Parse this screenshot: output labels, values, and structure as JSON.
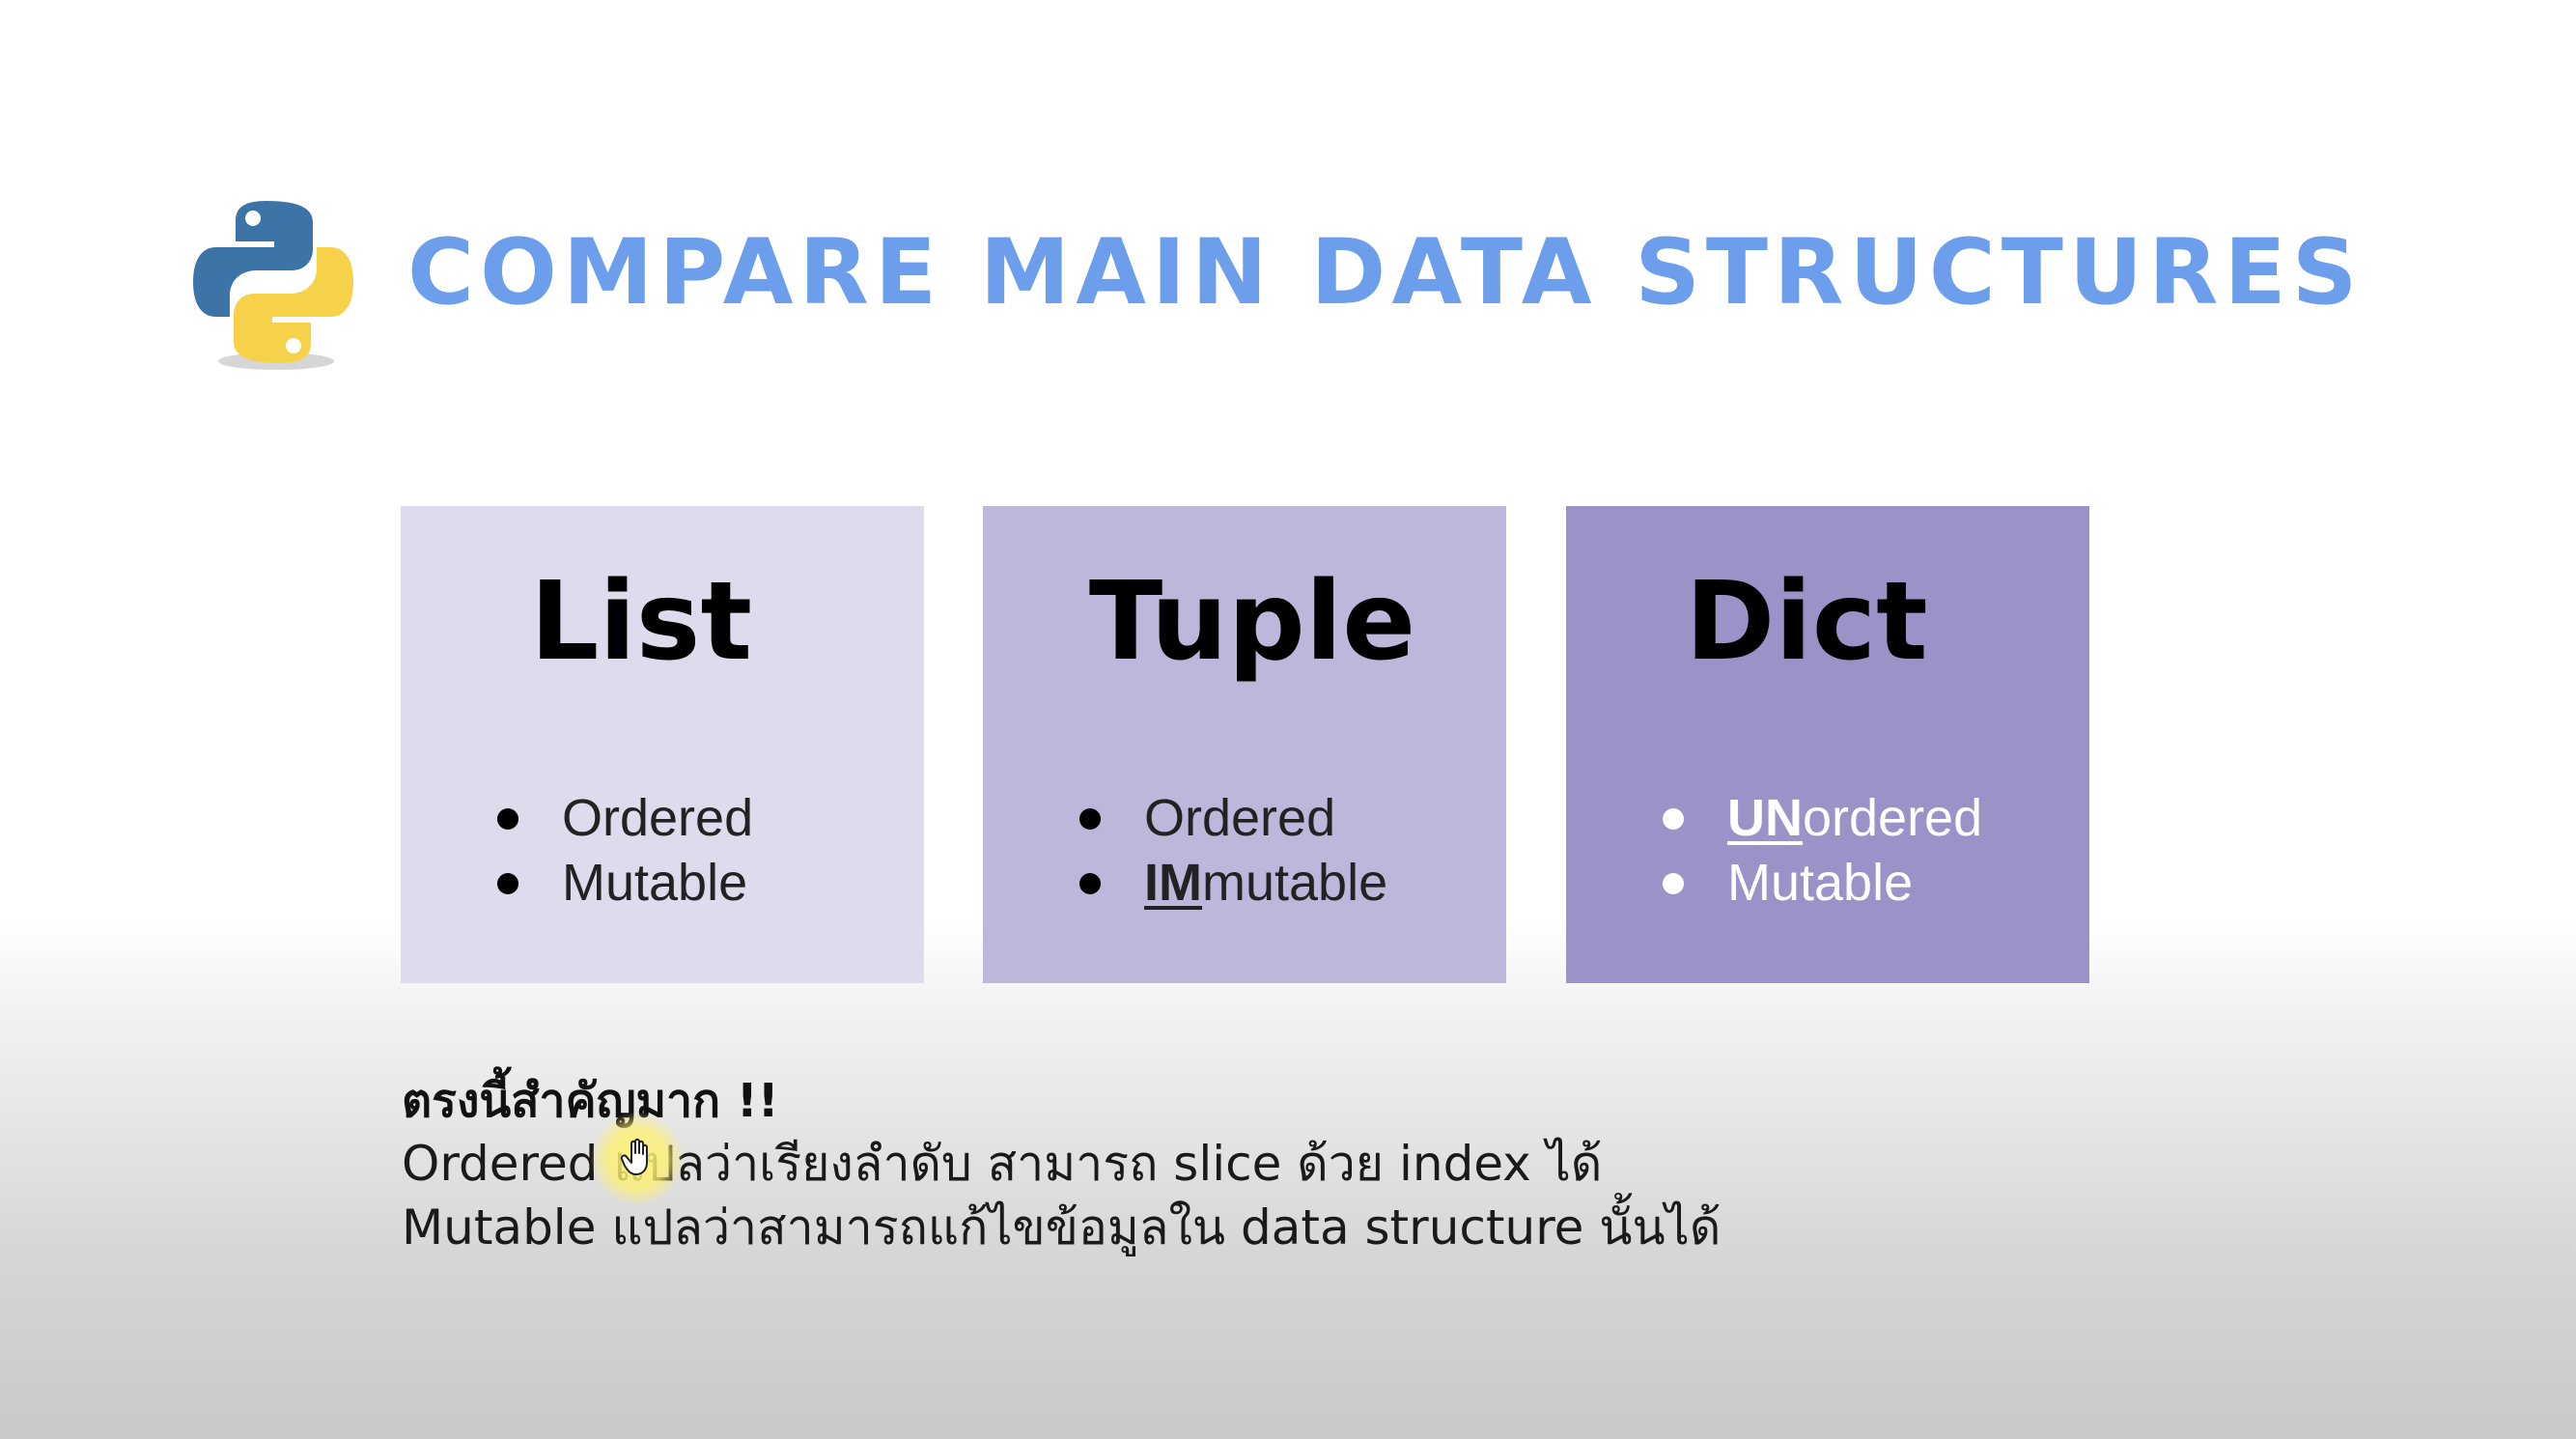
{
  "slide": {
    "title": "COMPARE MAIN DATA STRUCTURES",
    "logo_icon": "python-logo",
    "cards": [
      {
        "title": "List",
        "background": "#dedbec",
        "bullets": [
          {
            "emphasis": "",
            "text": "Ordered"
          },
          {
            "emphasis": "",
            "text": "Mutable"
          }
        ]
      },
      {
        "title": "Tuple",
        "background": "#bdb7db",
        "bullets": [
          {
            "emphasis": "",
            "text": "Ordered"
          },
          {
            "emphasis": "IM",
            "text": "mutable"
          }
        ]
      },
      {
        "title": "Dict",
        "background": "#9b93c7",
        "bullets": [
          {
            "emphasis": "UN",
            "text": "ordered"
          },
          {
            "emphasis": "",
            "text": "Mutable"
          }
        ]
      }
    ],
    "notes": {
      "heading": "ตรงนี้สำคัญมาก !!",
      "lines": [
        "Ordered แปลว่าเรียงลำดับ สามารถ slice ด้วย index ได้",
        "Mutable แปลว่าสามารถแก้ไขข้อมูลใน data structure นั้นได้"
      ]
    },
    "colors": {
      "title": "#6d9eeb",
      "python_blue": "#3d74a8",
      "python_yellow": "#f6d24a"
    },
    "cursor_icon": "hand-pointer-icon"
  }
}
